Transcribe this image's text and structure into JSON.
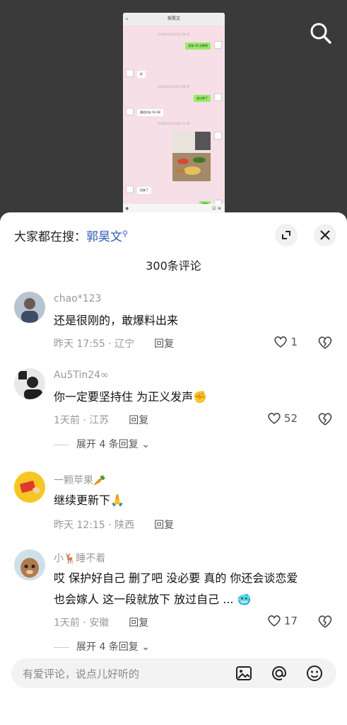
{
  "video": {
    "chat_title": "郝昊文",
    "messages": [
      {
        "kind": "time",
        "text": "2020年10月10日 09:41"
      },
      {
        "kind": "sent",
        "text": "还有 10 分钟到"
      },
      {
        "kind": "recv",
        "text": "好"
      },
      {
        "kind": "time",
        "text": "2020年10月10日 09:55"
      },
      {
        "kind": "sent",
        "text": "去过来了"
      },
      {
        "kind": "recv",
        "text": "通话时长 03:38"
      },
      {
        "kind": "time",
        "text": "2020年10月10日 11:40"
      },
      {
        "kind": "recv",
        "text": "回来了"
      },
      {
        "kind": "sent",
        "text": "嗯嗯"
      }
    ]
  },
  "sheet": {
    "search_prefix": "大家都在搜：",
    "search_keyword": "郭昊文",
    "comment_count": "300条评论"
  },
  "comments": [
    {
      "user": "chao*123",
      "text": "还是很刚的，敢爆料出来",
      "time": "昨天 17:55 · 辽宁",
      "reply": "回复",
      "likes": "1"
    },
    {
      "user": "Au5Tin24∞",
      "text": "你一定要坚持住 为正义发声✊",
      "time": "1天前 · 江苏",
      "reply": "回复",
      "likes": "52",
      "expand": "展开 4 条回复"
    },
    {
      "user": "一颗苹果🥕",
      "text": "继续更新下🙏",
      "time": "昨天 12:15 · 陕西",
      "reply": "回复",
      "likes": ""
    },
    {
      "user": "小🦌睡不着",
      "text_line1": "哎 保护好自己 删了吧 没必要 真的 你还会谈恋爱",
      "text_line2": "也会嫁人 这一段就放下 放过自己 ... 🥶",
      "time": "1天前 · 安徽",
      "reply": "回复",
      "likes": "17",
      "expand": "展开 4 条回复"
    }
  ],
  "input": {
    "placeholder": "有爱评论，说点儿好听的"
  },
  "icons": [
    "search-icon",
    "expand-icon",
    "close-icon",
    "heart-icon",
    "broken-heart-icon",
    "image-icon",
    "at-icon",
    "emoji-icon",
    "chevron-down-icon"
  ],
  "colors": {
    "keyword": "#2d5bb8",
    "chat_bg": "#f6dfe6",
    "bubble_green": "#95ec69"
  }
}
